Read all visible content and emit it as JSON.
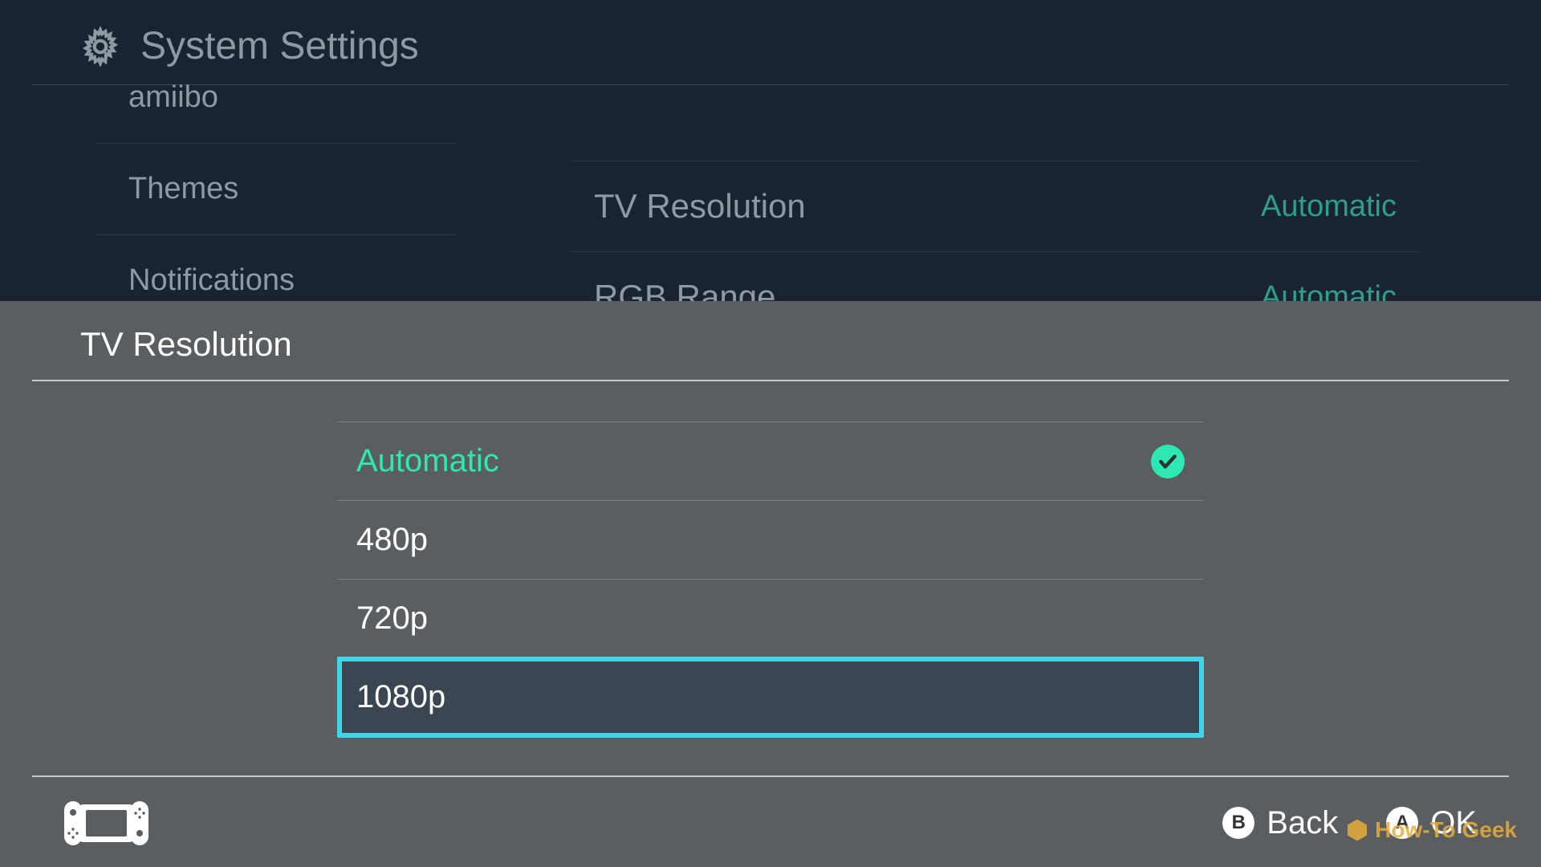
{
  "header": {
    "title": "System Settings"
  },
  "sidebar": {
    "items": [
      {
        "label": "amiibo"
      },
      {
        "label": "Themes"
      },
      {
        "label": "Notifications"
      }
    ]
  },
  "settings": {
    "rows": [
      {
        "label": "TV Resolution",
        "value": "Automatic"
      },
      {
        "label": "RGB Range",
        "value": "Automatic"
      }
    ]
  },
  "modal": {
    "title": "TV Resolution",
    "options": [
      {
        "label": "Automatic",
        "selected": true,
        "highlighted": false
      },
      {
        "label": "480p",
        "selected": false,
        "highlighted": false
      },
      {
        "label": "720p",
        "selected": false,
        "highlighted": false
      },
      {
        "label": "1080p",
        "selected": false,
        "highlighted": true
      }
    ]
  },
  "footer": {
    "buttons": [
      {
        "key": "B",
        "label": "Back"
      },
      {
        "key": "A",
        "label": "OK"
      }
    ]
  },
  "watermark": "How-To Geek"
}
